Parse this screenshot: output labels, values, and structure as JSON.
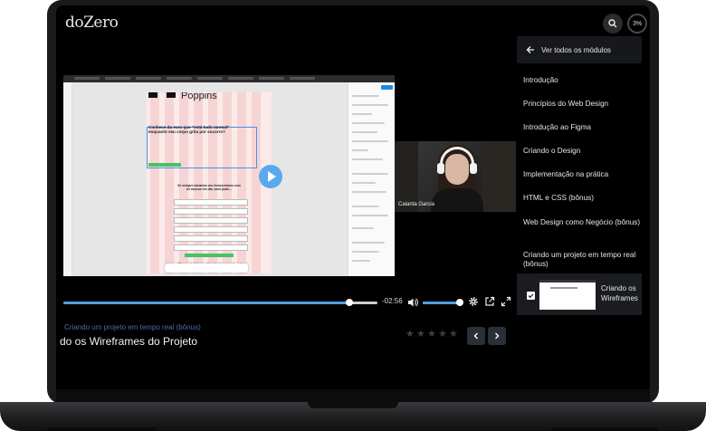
{
  "app": {
    "logo": "doZero",
    "progress_label": "3%"
  },
  "player": {
    "presenter_name": "Calanta Garcia",
    "time_remaining": "-02:56",
    "progress": 0.91,
    "volume": 0.98
  },
  "figma_mock": {
    "font_title": "Poppins",
    "heading": "Conhece da euro que \"está tudo normal\" enquanto seu corpo grita por socorro?",
    "subheading": "Se sempre tomando seu fornecedores com os nossos em dia, você pode...",
    "footer": "Chegar de informações rápidas e confusas!"
  },
  "lesson": {
    "module": "Criando um projeto em tempo real (bônus)",
    "title": "do os Wireframes do Projeto",
    "rating_stars": [
      "★",
      "★",
      "★",
      "★",
      "★"
    ]
  },
  "sidebar": {
    "back_label": "Ver todos os módulos",
    "modules": [
      "Introdução",
      "Princípios do Web Design",
      "Introdução ao Figma",
      "Criando o Design",
      "Implementação na prática",
      "HTML e CSS (bônus)",
      "Web Design como Negócio (bônus)",
      "Criando um projeto em tempo real (bônus)"
    ],
    "current_lesson": "Criando os Wireframes"
  },
  "colors": {
    "accent": "#4f9fe8",
    "background": "#000000",
    "panel": "#17181b",
    "crumb": "#4a6ea8"
  }
}
